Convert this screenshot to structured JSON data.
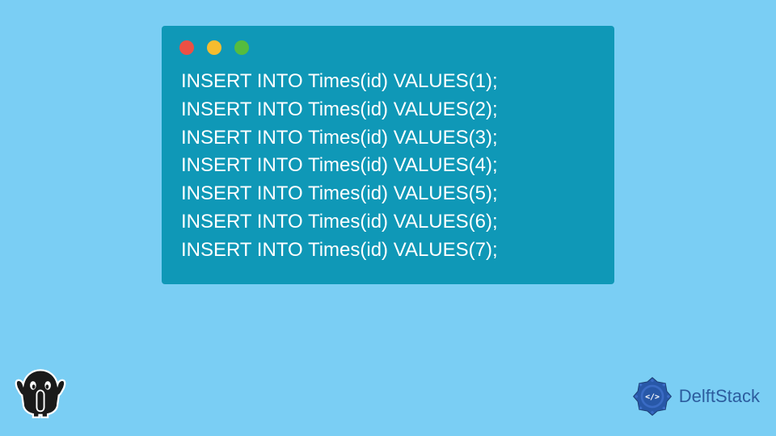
{
  "code": {
    "lines": [
      "INSERT INTO Times(id) VALUES(1);",
      "INSERT INTO Times(id) VALUES(2);",
      "INSERT INTO Times(id) VALUES(3);",
      "INSERT INTO Times(id) VALUES(4);",
      "INSERT INTO Times(id) VALUES(5);",
      "INSERT INTO Times(id) VALUES(6);",
      "INSERT INTO Times(id) VALUES(7);"
    ]
  },
  "brand": {
    "name": "DelftStack"
  },
  "colors": {
    "background": "#7ACEF4",
    "window": "#0F98B7",
    "brandText": "#2C5C9E"
  }
}
